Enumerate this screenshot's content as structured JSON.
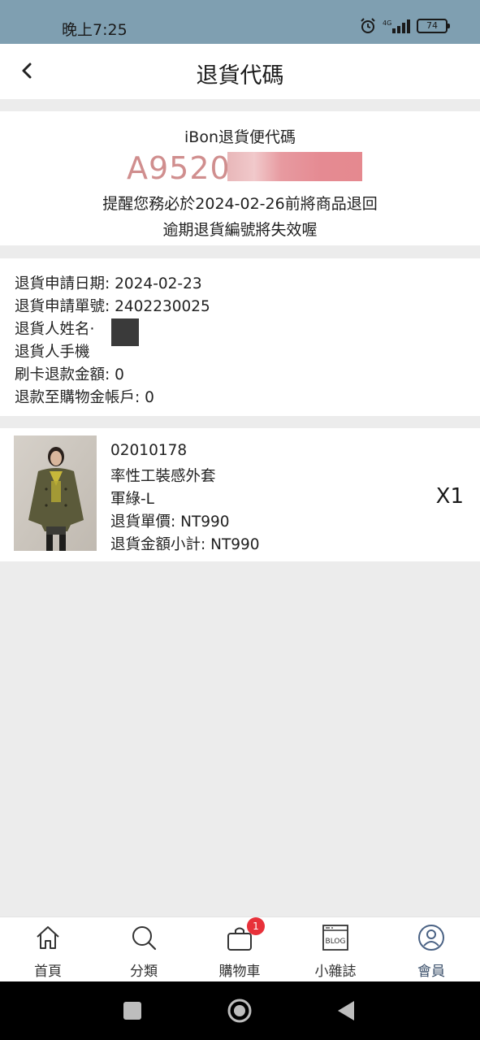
{
  "status_bar": {
    "time": "晚上7:25",
    "network": "4G",
    "battery": "74"
  },
  "header": {
    "title": "退貨代碼"
  },
  "return_code": {
    "label": "iBon退貨便代碼",
    "code_visible": "A95205",
    "reminder_line1": "提醒您務必於2024-02-26前將商品退回",
    "reminder_line2": "逾期退貨編號將失效喔"
  },
  "return_info": {
    "date": "退貨申請日期: 2024-02-23",
    "order_no": "退貨申請單號: 2402230025",
    "name": "退貨人姓名·",
    "phone": "退貨人手機",
    "card_refund": "刷卡退款金額: 0",
    "credit_refund": "退款至購物金帳戶: 0"
  },
  "product": {
    "sku": "02010178",
    "name": "率性工裝感外套",
    "variant": "軍綠-L",
    "unit_price": "退貨單價: NT990",
    "subtotal": "退貨金額小計: NT990",
    "quantity": "X1"
  },
  "tabbar": {
    "items": [
      {
        "label": "首頁",
        "icon": "home-icon"
      },
      {
        "label": "分類",
        "icon": "search-icon"
      },
      {
        "label": "購物車",
        "icon": "shopping-bag-icon",
        "badge": "1"
      },
      {
        "label": "小雜誌",
        "icon": "blog-icon",
        "icon_text": "BLOG"
      },
      {
        "label": "會員",
        "icon": "user-icon",
        "active": true
      }
    ]
  },
  "colors": {
    "status_bar": "#7f9fb1",
    "code_text": "#d08e8e",
    "badge": "#e8313a",
    "active_tab": "#3a4f6a"
  }
}
